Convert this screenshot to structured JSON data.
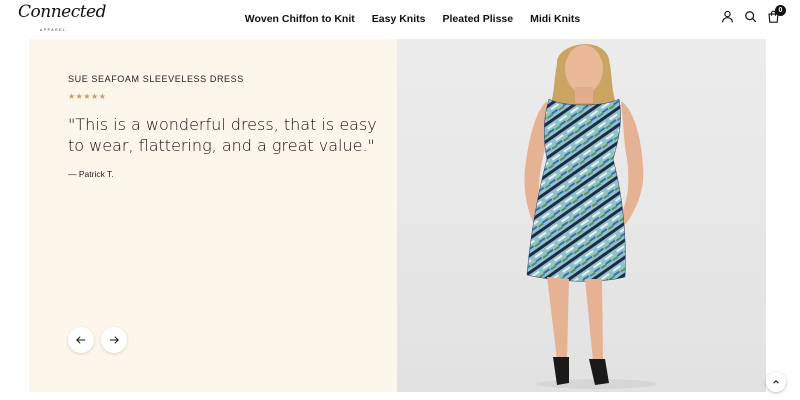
{
  "brand": {
    "logo_text": "Connected",
    "logo_sub": "APPAREL"
  },
  "nav": {
    "items": [
      {
        "label": "Woven Chiffon to Knit"
      },
      {
        "label": "Easy Knits"
      },
      {
        "label": "Pleated Plisse"
      },
      {
        "label": "Midi Knits"
      }
    ]
  },
  "header_icons": {
    "account": "user-icon",
    "search": "search-icon",
    "cart": "bag-icon",
    "cart_count": "0"
  },
  "testimonial": {
    "product_name": "SUE SEAFOAM SLEEVELESS DRESS",
    "rating": 5,
    "stars": "★★★★★",
    "quote": "\"This is a wonderful dress, that is easy to wear, flattering, and a great value.\"",
    "author": "—   Patrick T."
  },
  "colors": {
    "panel_bg": "#fdf6ea",
    "photo_bg": "#eaeaea",
    "star_color": "#c99a6b",
    "text": "#111111"
  }
}
